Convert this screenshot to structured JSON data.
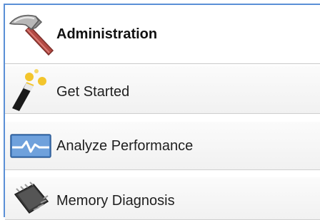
{
  "panel": {
    "accent_color": "#5a8fd6",
    "header": {
      "label": "Administration",
      "icon": "hammer-icon"
    },
    "items": [
      {
        "label": "Get Started",
        "icon": "magic-wand-icon"
      },
      {
        "label": "Analyze Performance",
        "icon": "performance-graph-icon"
      },
      {
        "label": "Memory Diagnosis",
        "icon": "memory-chip-icon"
      }
    ]
  }
}
